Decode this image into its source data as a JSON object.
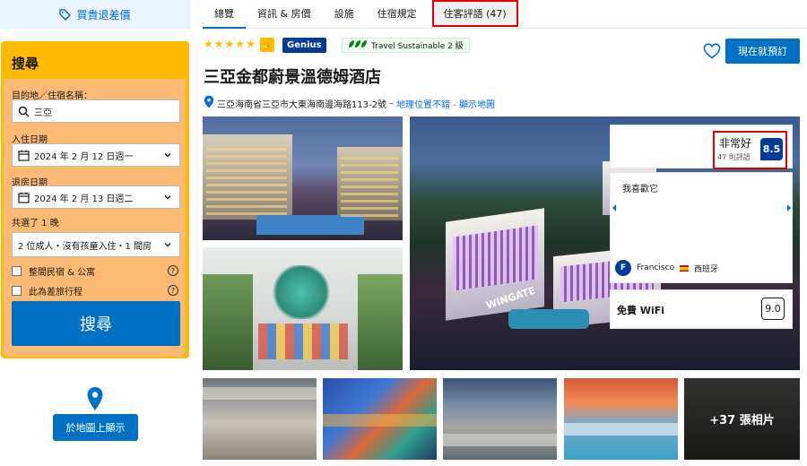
{
  "sidebar": {
    "price_match_label": "買貴退差價",
    "search_title": "搜尋",
    "destination_label": "目的地／住宿名稱：",
    "destination_value": "三亞",
    "checkin_label": "入住日期",
    "checkin_value": "2024 年 2 月 12 日週一",
    "checkout_label": "退房日期",
    "checkout_value": "2024 年 2 月 13 日週二",
    "nights_label": "共選了 1 晚",
    "guests_value": "2 位成人・沒有孩童入住・1 間房",
    "checkbox_homes": "整間民宿 & 公寓",
    "checkbox_work": "此為差旅行程",
    "help_glyph": "?",
    "search_button": "搜尋",
    "map_button": "於地圖上顯示"
  },
  "tabs": [
    {
      "label": "總覽"
    },
    {
      "label": "資訊 & 房價"
    },
    {
      "label": "設施"
    },
    {
      "label": "住宿規定"
    },
    {
      "label": "住客評語 (47)"
    }
  ],
  "header": {
    "star_count": 5,
    "star_glyph": "★",
    "thumb_glyph": "👍",
    "genius_label": "Genius",
    "sustainable_label": "Travel Sustainable 2 級",
    "reserve_button": "現在就預訂",
    "hotel_name": "三亞金都蔚景溫德姆酒店",
    "address": "三亞海南省三亞市大東海南邊海路113-2號",
    "address_dash": "–",
    "location_link": "地理位置不錯 - 顯示地圖"
  },
  "photos": {
    "more_label": "+37 張相片",
    "brand_text": "WINGATE"
  },
  "review": {
    "score_word": "非常好",
    "review_count": "47 則評語",
    "score": "8.5",
    "quote": "我喜歡它",
    "reviewer_initial": "F",
    "reviewer_name": "Francisco",
    "reviewer_country": "西班牙",
    "wifi_label": "免費 WiFi",
    "wifi_score": "9.0"
  },
  "colors": {
    "brand_blue": "#003b95",
    "action_blue": "#0071c2",
    "link_blue": "#006ce4",
    "search_yellow": "#febb02",
    "highlight_red": "#e00000"
  }
}
